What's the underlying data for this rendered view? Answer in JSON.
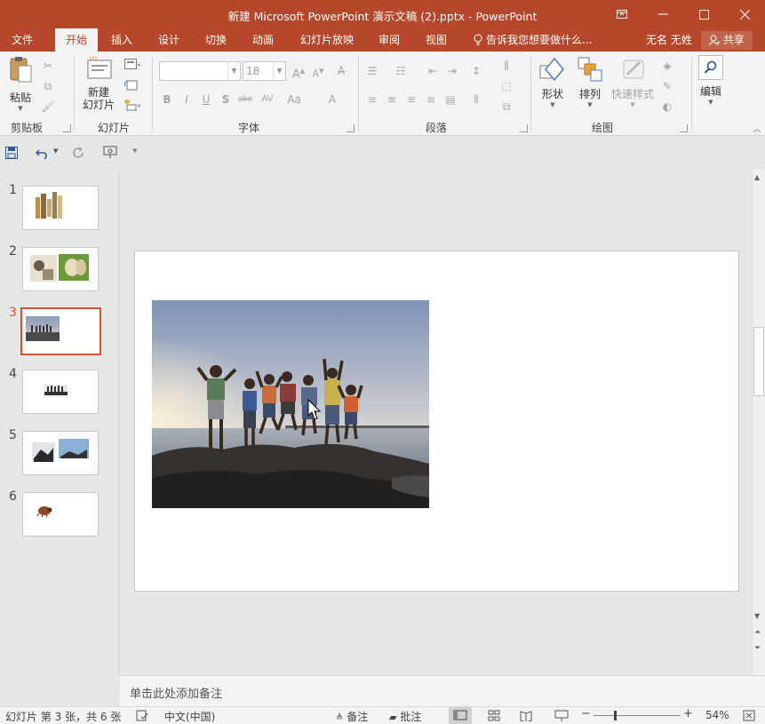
{
  "window": {
    "title": "新建 Microsoft PowerPoint 演示文稿 (2).pptx - PowerPoint"
  },
  "tabs": [
    {
      "label": "文件"
    },
    {
      "label": "开始",
      "active": true
    },
    {
      "label": "插入"
    },
    {
      "label": "设计"
    },
    {
      "label": "切换"
    },
    {
      "label": "动画"
    },
    {
      "label": "幻灯片放映"
    },
    {
      "label": "审阅"
    },
    {
      "label": "视图"
    }
  ],
  "tell_me": "告诉我您想要做什么...",
  "user": "无名 无姓",
  "share_label": "共享",
  "ribbon": {
    "clipboard": {
      "paste_label": "粘贴",
      "group_label": "剪贴板"
    },
    "slides": {
      "new_slide_label": "新建\n幻灯片",
      "group_label": "幻灯片"
    },
    "font": {
      "font_name": "",
      "font_size": "18",
      "group_label": "字体"
    },
    "paragraph": {
      "group_label": "段落"
    },
    "drawing": {
      "shapes_label": "形状",
      "arrange_label": "排列",
      "quick_styles_label": "快速样式",
      "group_label": "绘图"
    },
    "editing": {
      "edit_label": "编辑"
    }
  },
  "thumbnails": [
    {
      "num": "1"
    },
    {
      "num": "2"
    },
    {
      "num": "3",
      "selected": true
    },
    {
      "num": "4"
    },
    {
      "num": "5"
    },
    {
      "num": "6"
    }
  ],
  "notes_placeholder": "单击此处添加备注",
  "status": {
    "slide_info": "幻灯片 第 3 张，共 6 张",
    "language": "中文(中国)",
    "notes_label": "备注",
    "comments_label": "批注",
    "zoom": "54%"
  },
  "colors": {
    "accent": "#b7472a",
    "selected_border": "#d35230"
  }
}
